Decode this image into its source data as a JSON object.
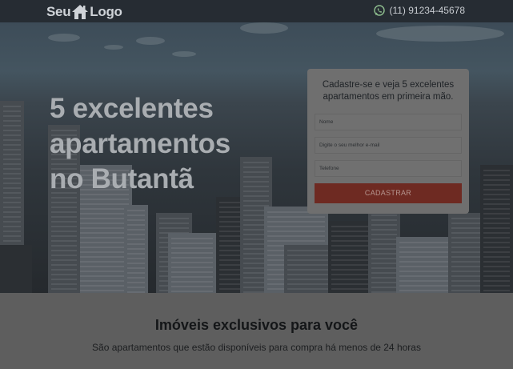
{
  "header": {
    "logo_left": "Seu",
    "logo_right": "Logo",
    "phone": "(11) 91234-45678"
  },
  "hero": {
    "headline_lines": [
      "5 excelentes",
      "apartamentos",
      "no Butantã"
    ]
  },
  "form": {
    "title": "Cadastre-se e veja 5 excelentes apartamentos em primeira mão.",
    "name_placeholder": "Nome",
    "email_placeholder": "Digite o seu melhor e-mail",
    "phone_placeholder": "Telefone",
    "submit_label": "CADASTRAR"
  },
  "section": {
    "title": "Imóveis exclusivos para você",
    "subtitle": "São apartamentos que estão disponíveis para compra há menos de 24 horas"
  },
  "icons": {
    "logo": "house-icon",
    "phone": "whatsapp-icon"
  }
}
